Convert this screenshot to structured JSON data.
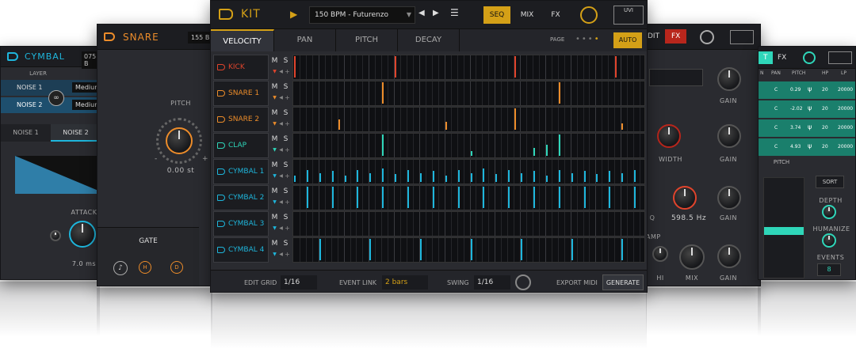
{
  "colors": {
    "accent_gold": "#d4a017",
    "kick": "#e0442c",
    "snare": "#ec8c2a",
    "clap": "#2fd6b9",
    "cymbal": "#1eb6dc"
  },
  "cymbal": {
    "title": "CYMBAL",
    "bpm": "075 B",
    "layer_label": "LAYER",
    "layers": [
      {
        "name": "NOISE 1",
        "mode": "Medium"
      },
      {
        "name": "NOISE 2",
        "mode": "Medium"
      }
    ],
    "tabs": [
      "NOISE 1",
      "NOISE 2"
    ],
    "attack_label": "ATTACK",
    "attack_value": "7.0 ms"
  },
  "snare": {
    "title": "SNARE",
    "bpm": "155 B",
    "pitch_label": "PITCH",
    "pitch_value": "0.00 st",
    "pitch_minus": "-",
    "pitch_plus": "+",
    "gate_label": "GATE",
    "btn_h": "H",
    "btn_d": "D"
  },
  "kit": {
    "title": "KIT",
    "preset": "150 BPM - Futurenzo",
    "nav": {
      "seq": "SEQ",
      "mix": "MIX",
      "fx": "FX"
    },
    "brand": "UVI",
    "tabs": [
      "VELOCITY",
      "PAN",
      "PITCH",
      "DECAY"
    ],
    "page_label": "PAGE",
    "auto_label": "AUTO",
    "mute": "M",
    "solo": "S",
    "tracks": [
      {
        "name": "KICK",
        "color": "#e0442c",
        "steps": [
          {
            "i": 0,
            "v": 0.95
          },
          {
            "i": 16,
            "v": 0.95
          },
          {
            "i": 35,
            "v": 0.95
          },
          {
            "i": 51,
            "v": 0.95
          }
        ]
      },
      {
        "name": "SNARE 1",
        "color": "#ec8c2a",
        "steps": [
          {
            "i": 14,
            "v": 0.95
          },
          {
            "i": 42,
            "v": 0.95
          }
        ]
      },
      {
        "name": "SNARE 2",
        "color": "#ec8c2a",
        "steps": [
          {
            "i": 7,
            "v": 0.45
          },
          {
            "i": 24,
            "v": 0.35
          },
          {
            "i": 35,
            "v": 0.95
          },
          {
            "i": 52,
            "v": 0.3
          }
        ]
      },
      {
        "name": "CLAP",
        "color": "#2fd6b9",
        "steps": [
          {
            "i": 14,
            "v": 0.95
          },
          {
            "i": 28,
            "v": 0.2
          },
          {
            "i": 38,
            "v": 0.35
          },
          {
            "i": 40,
            "v": 0.5
          },
          {
            "i": 42,
            "v": 0.95
          }
        ]
      },
      {
        "name": "CYMBAL 1",
        "color": "#1eb6dc",
        "steps": [
          {
            "i": 0,
            "v": 0.3
          },
          {
            "i": 2,
            "v": 0.55
          },
          {
            "i": 4,
            "v": 0.4
          },
          {
            "i": 6,
            "v": 0.5
          },
          {
            "i": 8,
            "v": 0.3
          },
          {
            "i": 10,
            "v": 0.55
          },
          {
            "i": 12,
            "v": 0.4
          },
          {
            "i": 14,
            "v": 0.6
          },
          {
            "i": 16,
            "v": 0.35
          },
          {
            "i": 18,
            "v": 0.55
          },
          {
            "i": 20,
            "v": 0.4
          },
          {
            "i": 22,
            "v": 0.5
          },
          {
            "i": 24,
            "v": 0.3
          },
          {
            "i": 26,
            "v": 0.55
          },
          {
            "i": 28,
            "v": 0.4
          },
          {
            "i": 30,
            "v": 0.6
          },
          {
            "i": 32,
            "v": 0.35
          },
          {
            "i": 34,
            "v": 0.55
          },
          {
            "i": 36,
            "v": 0.4
          },
          {
            "i": 38,
            "v": 0.5
          },
          {
            "i": 40,
            "v": 0.3
          },
          {
            "i": 42,
            "v": 0.55
          },
          {
            "i": 44,
            "v": 0.4
          },
          {
            "i": 46,
            "v": 0.5
          },
          {
            "i": 48,
            "v": 0.35
          },
          {
            "i": 50,
            "v": 0.5
          },
          {
            "i": 52,
            "v": 0.4
          },
          {
            "i": 54,
            "v": 0.55
          }
        ]
      },
      {
        "name": "CYMBAL 2",
        "color": "#1eb6dc",
        "steps": [
          {
            "i": 2,
            "v": 0.95
          },
          {
            "i": 6,
            "v": 0.95
          },
          {
            "i": 10,
            "v": 0.95
          },
          {
            "i": 14,
            "v": 0.95
          },
          {
            "i": 18,
            "v": 0.95
          },
          {
            "i": 22,
            "v": 0.95
          },
          {
            "i": 26,
            "v": 0.95
          },
          {
            "i": 30,
            "v": 0.95
          },
          {
            "i": 34,
            "v": 0.95
          },
          {
            "i": 38,
            "v": 0.95
          },
          {
            "i": 42,
            "v": 0.95
          },
          {
            "i": 46,
            "v": 0.95
          },
          {
            "i": 50,
            "v": 0.95
          },
          {
            "i": 54,
            "v": 0.95
          }
        ]
      },
      {
        "name": "CYMBAL 3",
        "color": "#1eb6dc",
        "steps": []
      },
      {
        "name": "CYMBAL 4",
        "color": "#1eb6dc",
        "steps": [
          {
            "i": 4,
            "v": 0.95
          },
          {
            "i": 12,
            "v": 0.95
          },
          {
            "i": 20,
            "v": 0.95
          },
          {
            "i": 28,
            "v": 0.95
          },
          {
            "i": 36,
            "v": 0.95
          },
          {
            "i": 44,
            "v": 0.95
          },
          {
            "i": 52,
            "v": 0.95
          }
        ]
      }
    ],
    "footer": {
      "edit_grid_label": "EDIT GRID",
      "edit_grid_value": "1/16",
      "event_link_label": "EVENT LINK",
      "event_link_value": "2 bars",
      "swing_label": "SWING",
      "swing_value": "1/16",
      "export_label": "EXPORT MIDI",
      "generate_label": "GENERATE"
    }
  },
  "fx_window": {
    "edit_label": "DIT",
    "fx_label": "FX",
    "gain1": "GAIN",
    "width": "WIDTH",
    "gain2": "GAIN",
    "q_label": "Q",
    "freq_value": "598.5 Hz",
    "gain3": "GAIN",
    "amp_label": "AMP",
    "hi": "HI",
    "mix": "MIX",
    "gain4": "GAIN"
  },
  "mix_window": {
    "tab_t": "T",
    "tab_fx": "FX",
    "headers": [
      "N",
      "PAN",
      "PITCH",
      "HP",
      "LP"
    ],
    "rows": [
      {
        "pan": "C",
        "pitch": "0.29",
        "hp": "20",
        "lp": "20000"
      },
      {
        "pan": "C",
        "pitch": "-2.02",
        "hp": "20",
        "lp": "20000"
      },
      {
        "pan": "C",
        "pitch": "3.74",
        "hp": "20",
        "lp": "20000"
      },
      {
        "pan": "C",
        "pitch": "4.93",
        "hp": "20",
        "lp": "20000"
      }
    ],
    "pitch_label": "PITCH",
    "sort_label": "SORT",
    "depth_label": "DEPTH",
    "humanize_label": "HUMANIZE",
    "events_label": "EVENTS",
    "events_value": "8"
  }
}
